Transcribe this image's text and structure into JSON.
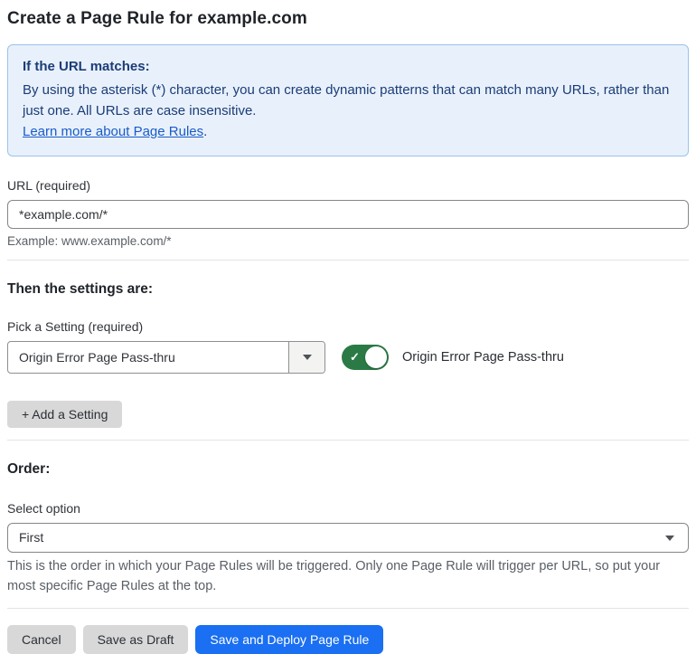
{
  "page": {
    "title": "Create a Page Rule for example.com"
  },
  "info_box": {
    "heading": "If the URL matches:",
    "body": "By using the asterisk (*) character, you can create dynamic patterns that can match many URLs, rather than just one. All URLs are case insensitive.",
    "link_label": "Learn more about Page Rules",
    "link_suffix": "."
  },
  "url_field": {
    "label": "URL (required)",
    "value": "*example.com/*",
    "helper": "Example: www.example.com/*"
  },
  "settings_section": {
    "heading": "Then the settings are:",
    "picker_label": "Pick a Setting (required)",
    "picker_value": "Origin Error Page Pass-thru",
    "toggle_state": "on",
    "toggle_check_glyph": "✓",
    "toggle_label": "Origin Error Page Pass-thru",
    "add_setting_label": "+ Add a Setting"
  },
  "order_section": {
    "heading": "Order:",
    "select_label": "Select option",
    "select_value": "First",
    "helper": "This is the order in which your Page Rules will be triggered. Only one Page Rule will trigger per URL, so put your most specific Page Rules at the top."
  },
  "footer": {
    "cancel_label": "Cancel",
    "save_draft_label": "Save as Draft",
    "save_deploy_label": "Save and Deploy Page Rule"
  },
  "colors": {
    "accent_blue": "#1a6ff2",
    "toggle_green": "#2b7a46",
    "info_background": "#e8f1fb",
    "info_border": "#9cc2ea",
    "info_text": "#1b3c78",
    "link_blue": "#1a5bc8"
  }
}
